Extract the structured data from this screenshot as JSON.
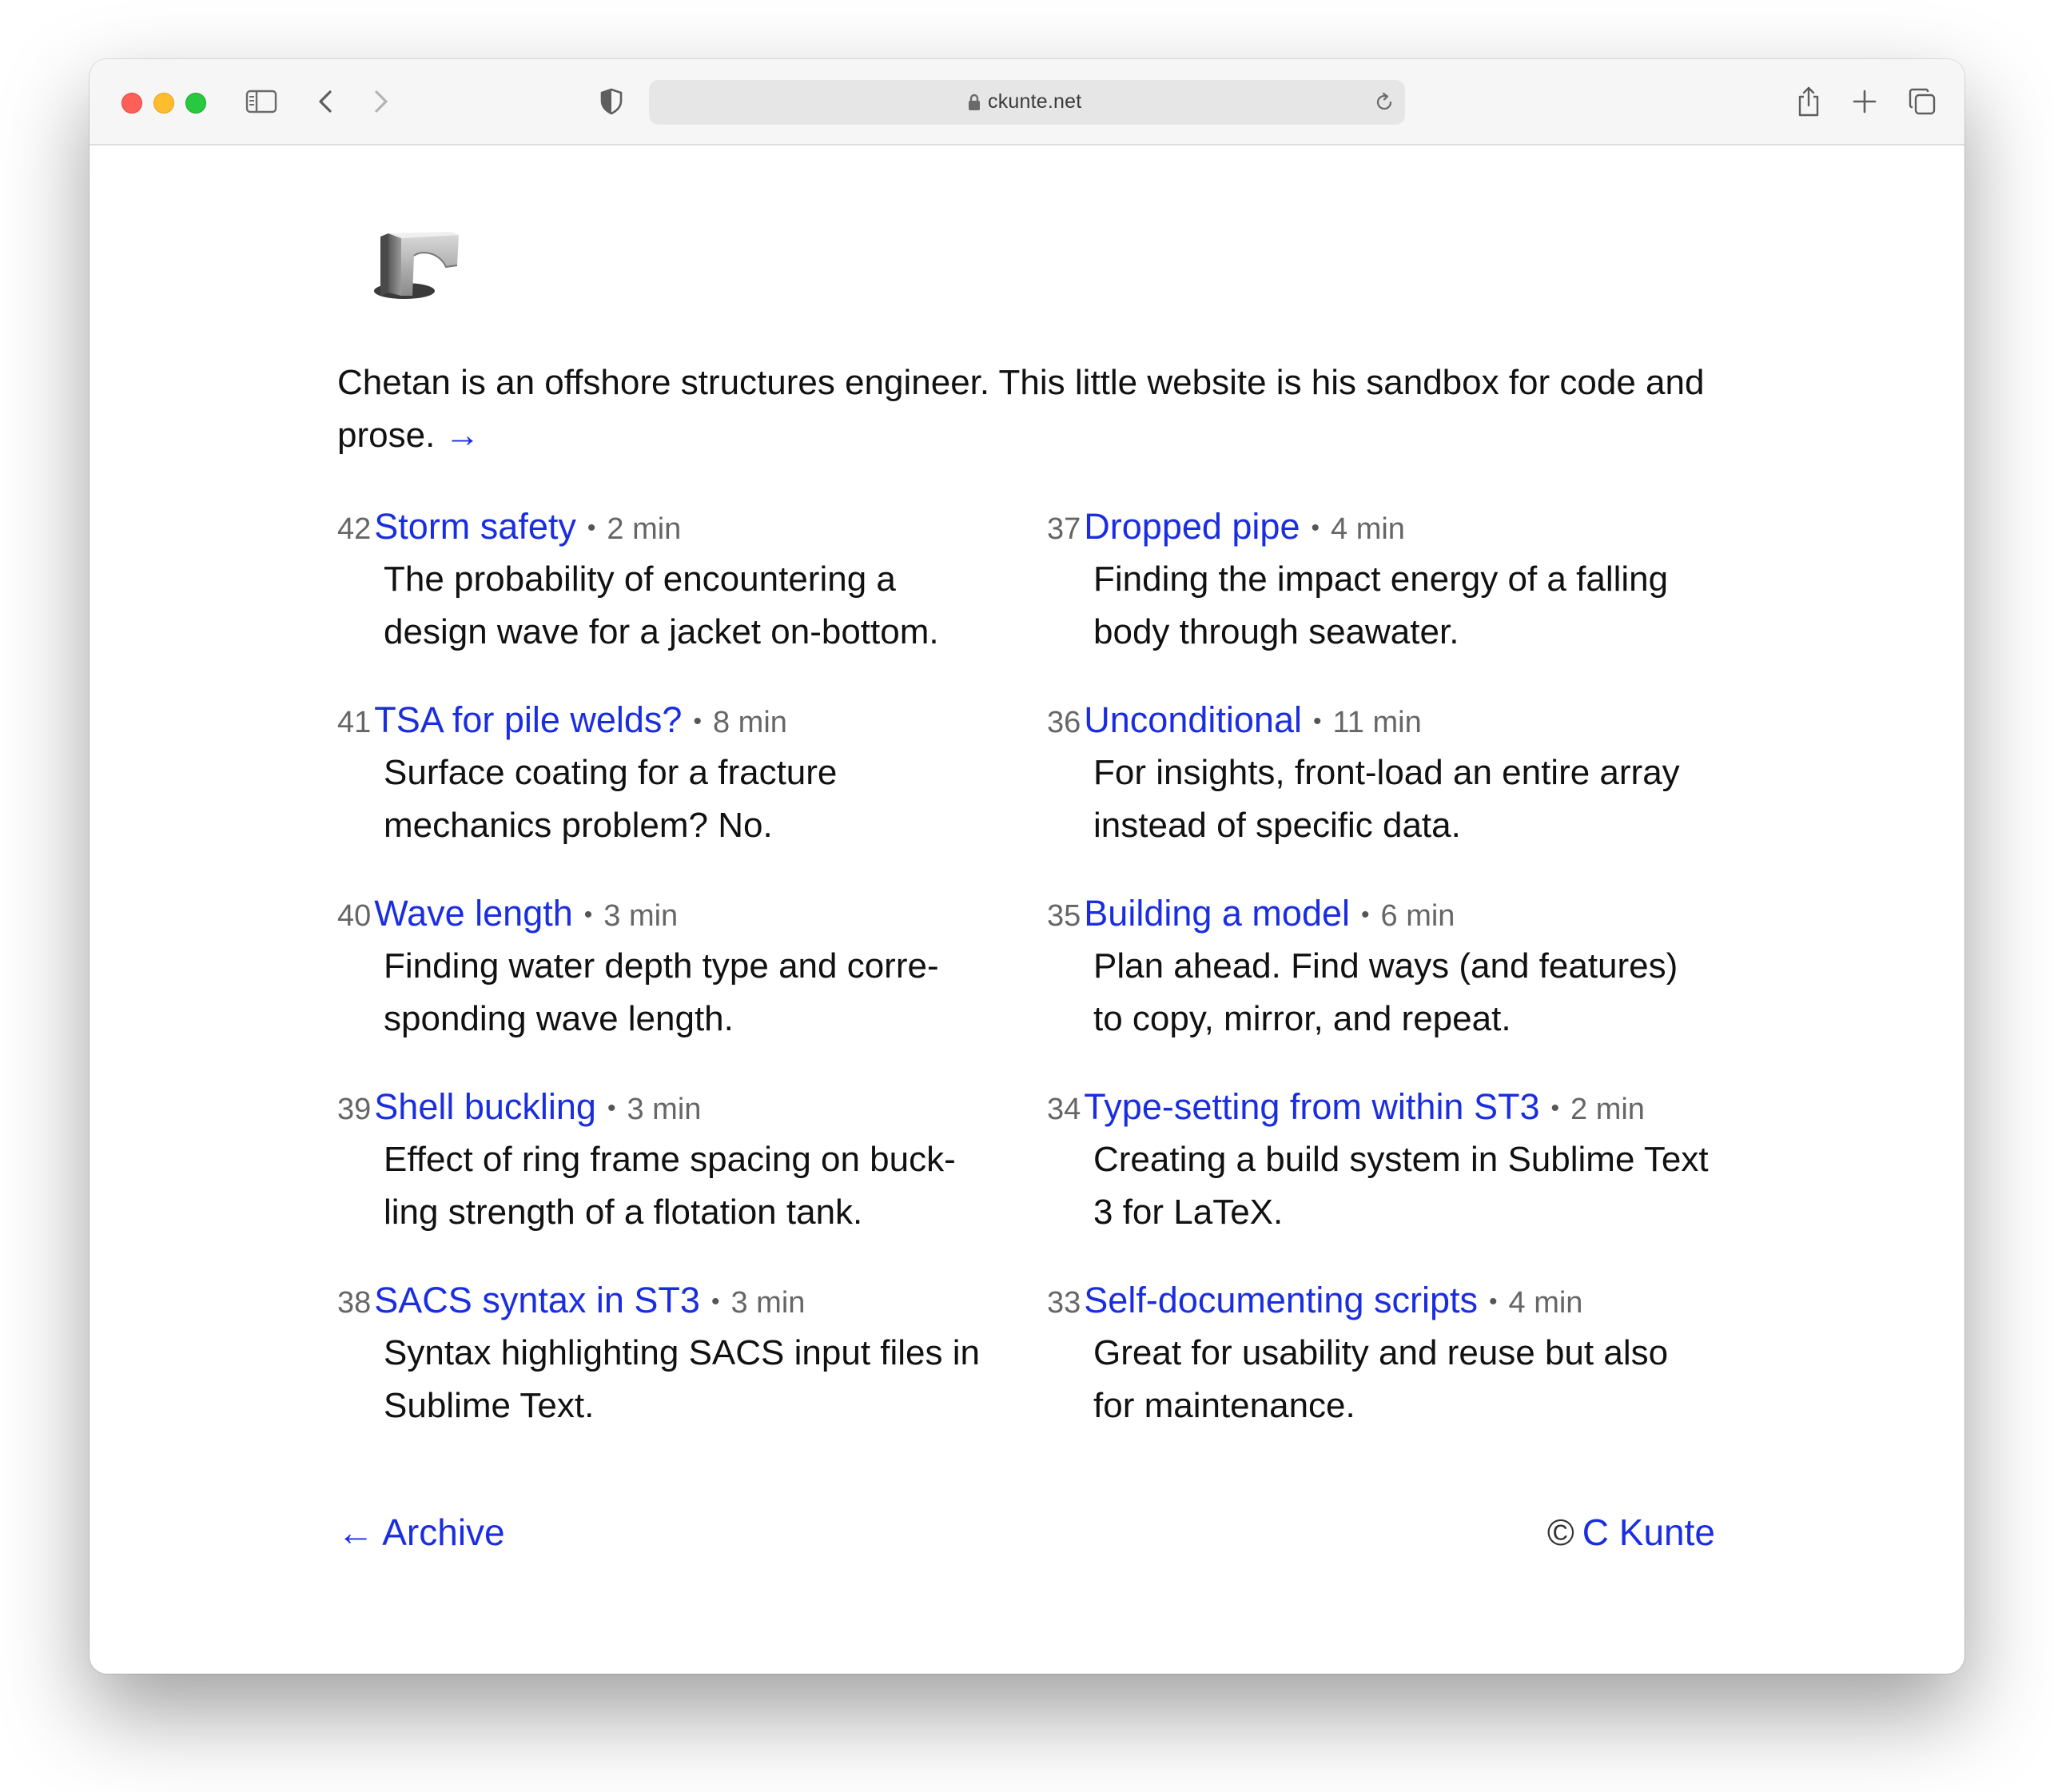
{
  "browser": {
    "url": "ckunte.net"
  },
  "page": {
    "intro_text": "Chetan is an offshore structures engineer. This little website is his sandbox for code and prose.",
    "intro_arrow": "→",
    "posts_left": [
      {
        "num": "42",
        "title": "Storm safety",
        "sep": "•",
        "mins": "2 min",
        "desc": "The probability of encountering a design wave for a jacket on-bottom."
      },
      {
        "num": "41",
        "title": "TSA for pile welds?",
        "sep": "•",
        "mins": "8 min",
        "desc": "Surface coating for a fracture mechanics problem? No."
      },
      {
        "num": "40",
        "title": "Wave length",
        "sep": "•",
        "mins": "3 min",
        "desc": "Finding water depth type and corre-sponding wave length."
      },
      {
        "num": "39",
        "title": "Shell buckling",
        "sep": "•",
        "mins": "3 min",
        "desc": "Effect of ring frame spacing on buck-ling strength of a flotation tank."
      },
      {
        "num": "38",
        "title": "SACS syntax in ST3",
        "sep": "•",
        "mins": "3 min",
        "desc": "Syntax highlighting SACS input files in Sublime Text."
      }
    ],
    "posts_right": [
      {
        "num": "37",
        "title": "Dropped pipe",
        "sep": "•",
        "mins": "4 min",
        "desc": "Finding the impact energy of a falling body through seawater."
      },
      {
        "num": "36",
        "title": "Unconditional",
        "sep": "•",
        "mins": "11 min",
        "desc": "For insights, front-load an entire array instead of specific data."
      },
      {
        "num": "35",
        "title": "Building a model",
        "sep": "•",
        "mins": "6 min",
        "desc": "Plan ahead. Find ways (and features) to copy, mirror, and repeat."
      },
      {
        "num": "34",
        "title": "Type-setting from within ST3",
        "sep": "•",
        "mins": "2 min",
        "desc": "Creating a build system in Sublime Text 3 for LaTeX."
      },
      {
        "num": "33",
        "title": "Self-documenting scripts",
        "sep": "•",
        "mins": "4 min",
        "desc": "Great for usability and reuse but also for maintenance."
      }
    ],
    "footer": {
      "archive_arrow": "←",
      "archive_label": "Archive",
      "copyright_symbol": "©",
      "copyright_name": "C Kunte"
    }
  },
  "colors": {
    "link": "#1a2ee0",
    "text": "#111111",
    "muted": "#666666"
  }
}
